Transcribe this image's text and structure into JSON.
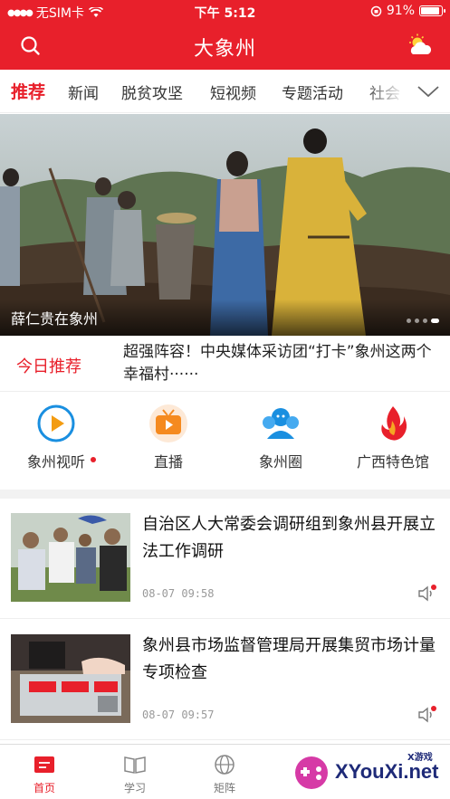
{
  "status_bar": {
    "carrier": "无SIM卡",
    "time": "下午 5:12",
    "battery": "91%",
    "battery_level": 0.91
  },
  "header": {
    "title": "大象州",
    "search_icon": "search-icon",
    "weather_icon": "weather-icon"
  },
  "tabs": [
    {
      "label": "推荐",
      "active": true
    },
    {
      "label": "新闻"
    },
    {
      "label": "脱贫攻坚"
    },
    {
      "label": "短视频"
    },
    {
      "label": "专题活动"
    },
    {
      "label": "社会"
    }
  ],
  "banner": {
    "caption": "薛仁贵在象州",
    "slides": 4,
    "active_slide": 3
  },
  "today": {
    "label": "今日推荐",
    "headline": "超强阵容！中央媒体采访团“打卡”象州这两个幸福村······"
  },
  "quick_links": [
    {
      "label": "象州视听",
      "icon": "play-circle-icon",
      "badge": true
    },
    {
      "label": "直播",
      "icon": "tv-icon"
    },
    {
      "label": "象州圈",
      "icon": "people-icon"
    },
    {
      "label": "广西特色馆",
      "icon": "flame-icon"
    }
  ],
  "news": [
    {
      "title": "自治区人大常委会调研组到象州县开展立法工作调研",
      "time": "08-07 09:58"
    },
    {
      "title": "象州县市场监督管理局开展集贸市场计量专项检查",
      "time": "08-07 09:57"
    }
  ],
  "bottom_nav": [
    {
      "label": "首页",
      "active": true
    },
    {
      "label": "学习"
    },
    {
      "label": "矩阵"
    }
  ],
  "watermark": {
    "text": "XYouXi.net",
    "small": "X游戏"
  },
  "colors": {
    "brand": "#e8202b",
    "accent_blue": "#1a8fe0",
    "accent_orange": "#f39c12"
  }
}
